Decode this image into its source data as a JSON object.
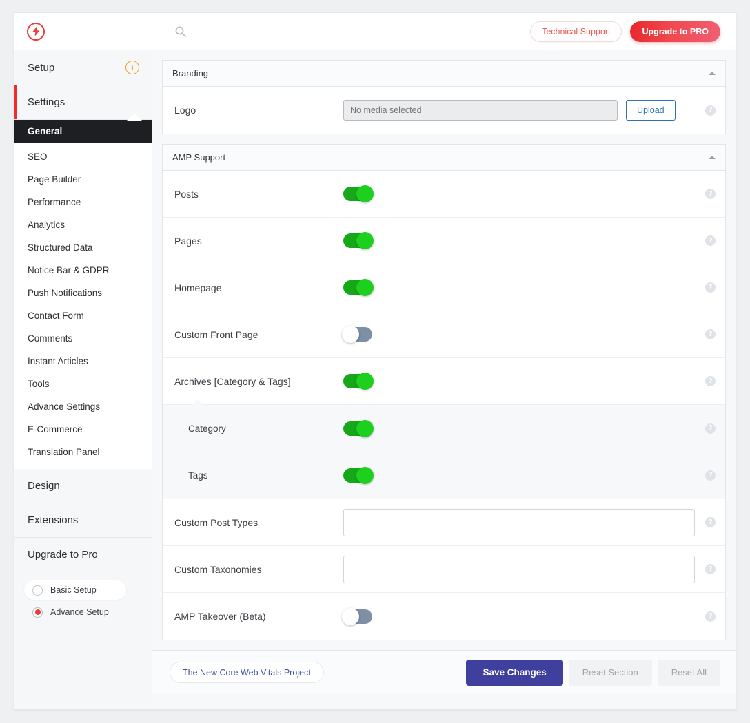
{
  "header": {
    "logo_icon": "amp-bolt-icon",
    "search_icon": "search-icon",
    "support_label": "Technical Support",
    "pro_label": "Upgrade to PRO",
    "pro_color": "#ef3b3b"
  },
  "sidebar": {
    "setup_label": "Setup",
    "setup_info_icon": "info-icon",
    "settings_label": "Settings",
    "settings_accent": "#ef2c2c",
    "settings_items": [
      {
        "label": "General",
        "selected": true
      },
      {
        "label": "SEO",
        "selected": false
      },
      {
        "label": "Page Builder",
        "selected": false
      },
      {
        "label": "Performance",
        "selected": false
      },
      {
        "label": "Analytics",
        "selected": false
      },
      {
        "label": "Structured Data",
        "selected": false
      },
      {
        "label": "Notice Bar & GDPR",
        "selected": false
      },
      {
        "label": "Push Notifications",
        "selected": false
      },
      {
        "label": "Contact Form",
        "selected": false
      },
      {
        "label": "Comments",
        "selected": false
      },
      {
        "label": "Instant Articles",
        "selected": false
      },
      {
        "label": "Tools",
        "selected": false
      },
      {
        "label": "Advance Settings",
        "selected": false
      },
      {
        "label": "E-Commerce",
        "selected": false
      },
      {
        "label": "Translation Panel",
        "selected": false
      }
    ],
    "design_label": "Design",
    "extensions_label": "Extensions",
    "upgrade_label": "Upgrade to Pro",
    "modes": [
      {
        "label": "Basic Setup",
        "selected": false
      },
      {
        "label": "Advance Setup",
        "selected": true
      }
    ]
  },
  "branding": {
    "title": "Branding",
    "collapse_icon": "chevron-up-icon",
    "logo_label": "Logo",
    "logo_value": "",
    "logo_placeholder": "No media selected",
    "upload_label": "Upload",
    "help_icon": "help-icon"
  },
  "amp_support": {
    "title": "AMP Support",
    "collapse_icon": "chevron-up-icon",
    "rows": [
      {
        "label": "Posts",
        "type": "toggle",
        "state": "on"
      },
      {
        "label": "Pages",
        "type": "toggle",
        "state": "on"
      },
      {
        "label": "Homepage",
        "type": "toggle",
        "state": "on"
      },
      {
        "label": "Custom Front Page",
        "type": "toggle",
        "state": "off"
      },
      {
        "label": "Archives [Category & Tags]",
        "type": "toggle",
        "state": "on"
      }
    ],
    "sub_rows": [
      {
        "label": "Category",
        "type": "toggle",
        "state": "on"
      },
      {
        "label": "Tags",
        "type": "toggle",
        "state": "on"
      }
    ],
    "tail_rows": [
      {
        "label": "Custom Post Types",
        "type": "text",
        "value": "",
        "placeholder": ""
      },
      {
        "label": "Custom Taxonomies",
        "type": "text",
        "value": "",
        "placeholder": ""
      },
      {
        "label": "AMP Takeover (Beta)",
        "type": "toggle",
        "state": "off"
      }
    ]
  },
  "footer": {
    "vitals_label": "The New Core Web Vitals Project",
    "save_label": "Save Changes",
    "reset_section_label": "Reset Section",
    "reset_all_label": "Reset All",
    "save_color": "#3f3f9e"
  }
}
